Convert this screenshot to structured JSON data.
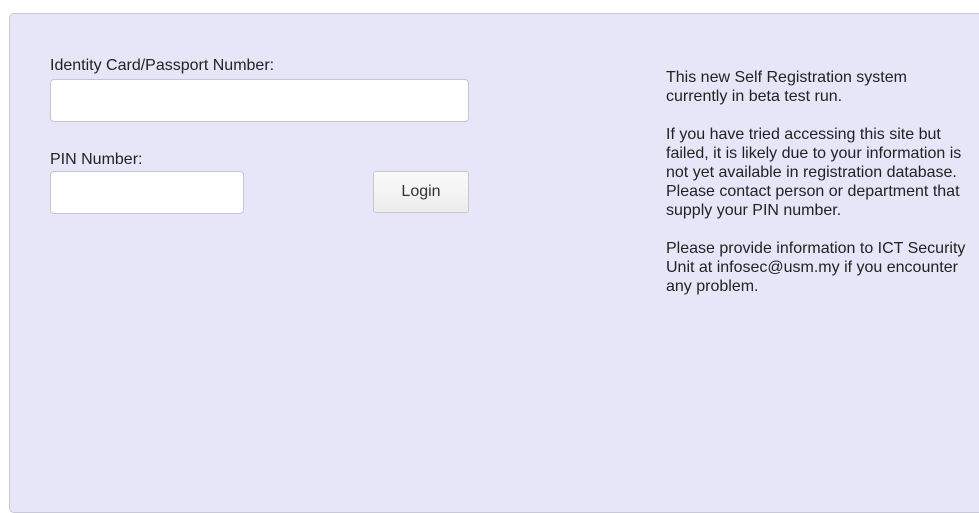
{
  "form": {
    "id_label": "Identity Card/Passport Number:",
    "id_value": "",
    "pin_label": "PIN Number:",
    "pin_value": "",
    "login_label": "Login"
  },
  "info": {
    "paragraphs": [
      "This new Self Registration system currently in beta test run.",
      "If you have tried accessing this site but failed, it is likely due to your information is not yet available in registration database. Please contact person or department that supply your PIN number.",
      "Please provide information to ICT Security Unit at infosec@usm.my if you encounter any problem."
    ]
  },
  "colors": {
    "panel_background": "#e6e6f8",
    "panel_border": "#c8c8d8"
  }
}
